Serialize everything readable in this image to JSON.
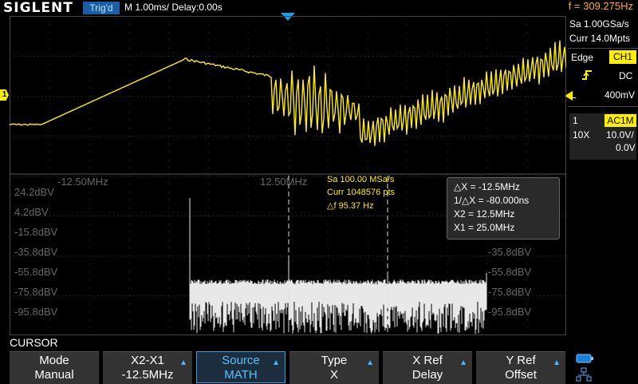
{
  "header": {
    "brand": "SIGLENT",
    "trigger_status": "Trig'd",
    "timebase": "M 1.00ms/ Delay:0.00s",
    "frequency": "f = 309.275Hz"
  },
  "acquisition": {
    "sample_rate": "Sa 1.00GSa/s",
    "memory": "Curr 14.0Mpts"
  },
  "trigger": {
    "type": "Edge",
    "source": "CH1",
    "coupling": "DC",
    "level_label": "L",
    "level": "400mV"
  },
  "channel": {
    "number": "1",
    "coupling": "AC1M",
    "probe": "10X",
    "scale": "10.0V/",
    "offset": "0.0V"
  },
  "fft": {
    "x_left": "-12.50MHz",
    "x_center": "12.50MHz",
    "sample_rate": "Sa 100.00 MSa/s",
    "points": "Curr 1048576 pts",
    "delta_f": "△f 95.37 Hz",
    "y_labels": [
      "24.2dBV",
      "4.2dBV",
      "-15.8dBV",
      "-35.8dBV",
      "-55.8dBV",
      "-75.8dBV",
      "-95.8dBV"
    ],
    "y_labels_right": [
      "-35.8dBV",
      "-55.8dBV",
      "-75.8dBV",
      "-95.8dBV"
    ]
  },
  "cursor_readout": {
    "dx": "△X = -12.5MHz",
    "inv_dx": "1/△X = -80.000ns",
    "x2": "X2 = 12.5MHz",
    "x1": "X1 = 25.0MHz"
  },
  "menu": {
    "title": "CURSOR",
    "items": [
      {
        "top": "Mode",
        "bottom": "Manual"
      },
      {
        "top": "X2-X1",
        "bottom": "-12.5MHz"
      },
      {
        "top": "Source",
        "bottom": "MATH"
      },
      {
        "top": "Type",
        "bottom": "X"
      },
      {
        "top": "X Ref",
        "bottom": "Delay"
      },
      {
        "top": "Y Ref",
        "bottom": "Offset"
      }
    ]
  },
  "markers": {
    "channel_marker": "1",
    "trigger_marker": "1"
  },
  "colors": {
    "ch1": "#ffee00",
    "math": "#e8e8e8",
    "accent": "#4fb4ff",
    "frequency": "#ffb000"
  }
}
